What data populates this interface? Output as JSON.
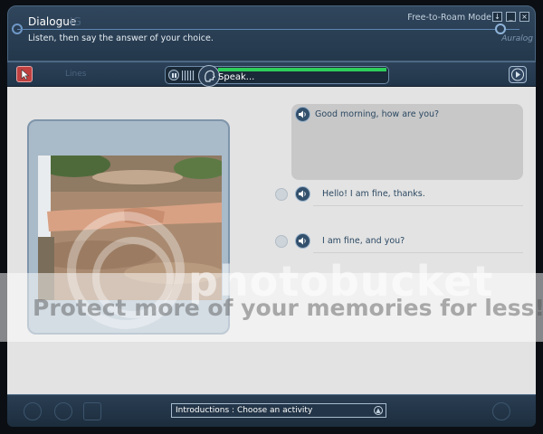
{
  "window": {
    "title": "Dialogue",
    "title_ghost": "IG",
    "instruction": "Listen, then say the answer of your choice.",
    "mode_label": "Free-to-Roam Mode",
    "buttons": {
      "down": "↓",
      "minimize": "_",
      "close": "×"
    },
    "brand": "Auralog"
  },
  "toolbar": {
    "ghost_label": "Lines",
    "speak_label": "Speak...",
    "level_fill_fraction": 1.0,
    "level_color": "#2ecc5b"
  },
  "dialogue": {
    "question": "Good morning, how are you?",
    "answers": [
      {
        "text": "Hello! I am fine, thanks."
      },
      {
        "text": "I am fine, and you?"
      }
    ]
  },
  "watermark": {
    "word": "photobucket",
    "band_text": "Protect more of your memories for less!"
  },
  "bottom": {
    "activity_text": "Introductions : Choose an activity"
  },
  "icons": [
    "pointer-icon",
    "pause-icon",
    "meter-icon",
    "microphone-icon",
    "next-icon",
    "speaker-icon",
    "home-icon",
    "back-icon",
    "forward-icon",
    "help-icon"
  ],
  "colors": {
    "panel": "#24384c",
    "accent_line": "#5e86b3",
    "content_bg": "#e3e3e3",
    "text_blue": "#2b4862"
  }
}
